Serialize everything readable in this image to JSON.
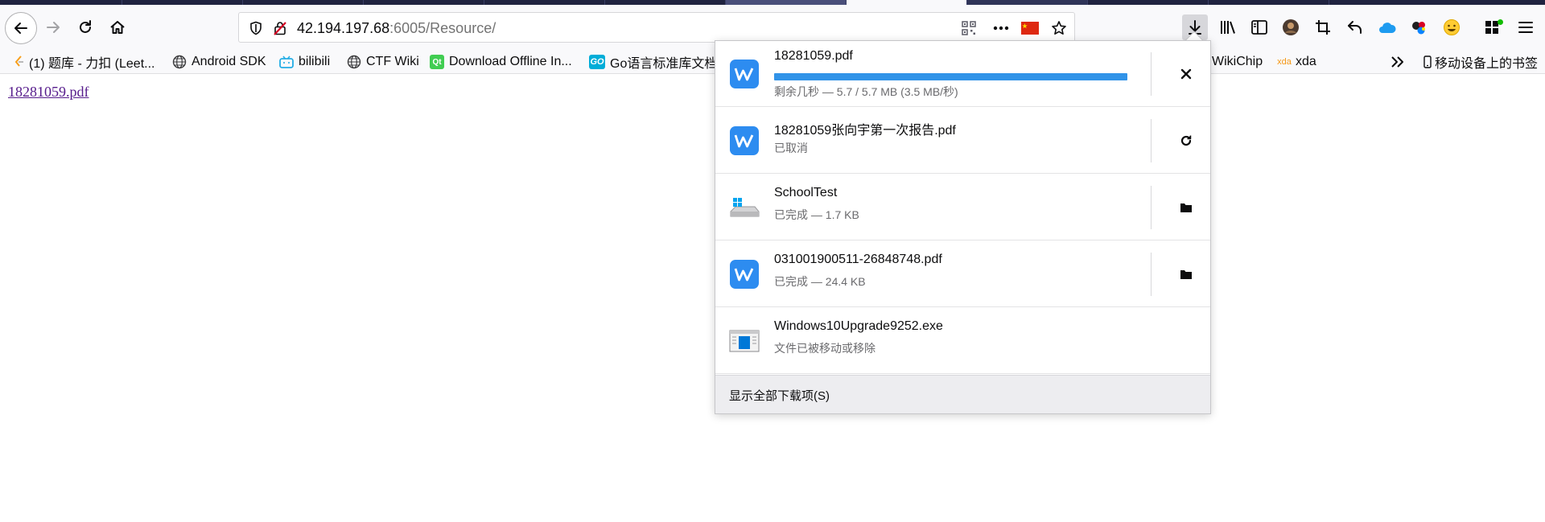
{
  "url": {
    "host": "42.194.197.68",
    "rest": ":6005/Resource/"
  },
  "bookmarks": [
    {
      "label": "(1) 题库 - 力扣 (Leet...",
      "icon": "leetcode-icon"
    },
    {
      "label": "Android SDK",
      "icon": "globe-icon"
    },
    {
      "label": "bilibili",
      "icon": "bilibili-icon"
    },
    {
      "label": "CTF Wiki",
      "icon": "globe-icon"
    },
    {
      "label": "Download Offline In...",
      "icon": "qt-icon"
    },
    {
      "label": "Go语言标准库文档",
      "icon": "go-icon"
    },
    {
      "label": "WikiChip",
      "icon": ""
    },
    {
      "label": "xda",
      "icon": "xda-icon",
      "icon_text": "xda"
    },
    {
      "label": "移动设备上的书签",
      "icon": "mobile-icon"
    }
  ],
  "page": {
    "link": "18281059.pdf"
  },
  "downloads": {
    "items": [
      {
        "name": "18281059.pdf",
        "status": "剩余几秒 — 5.7 / 5.7 MB (3.5 MB/秒)",
        "progress": 1.0,
        "action": "cancel-icon",
        "file_icon": "wps-icon"
      },
      {
        "name": "18281059张向宇第一次报告.pdf",
        "status": "已取消",
        "action": "retry-icon",
        "file_icon": "wps-icon"
      },
      {
        "name": "SchoolTest",
        "status": "已完成 — 1.7 KB",
        "action": "folder-icon",
        "file_icon": "drive-icon"
      },
      {
        "name": "031001900511-26848748.pdf",
        "status": "已完成 — 24.4 KB",
        "action": "folder-icon",
        "file_icon": "wps-icon"
      },
      {
        "name": "Windows10Upgrade9252.exe",
        "status": "文件已被移动或移除",
        "action": "",
        "file_icon": "exe-icon"
      }
    ],
    "footer": "显示全部下载项(S)"
  },
  "colors": {
    "progress": "#3193e8",
    "link_visited": "#551a8b",
    "wps": "#2d8cf0"
  }
}
